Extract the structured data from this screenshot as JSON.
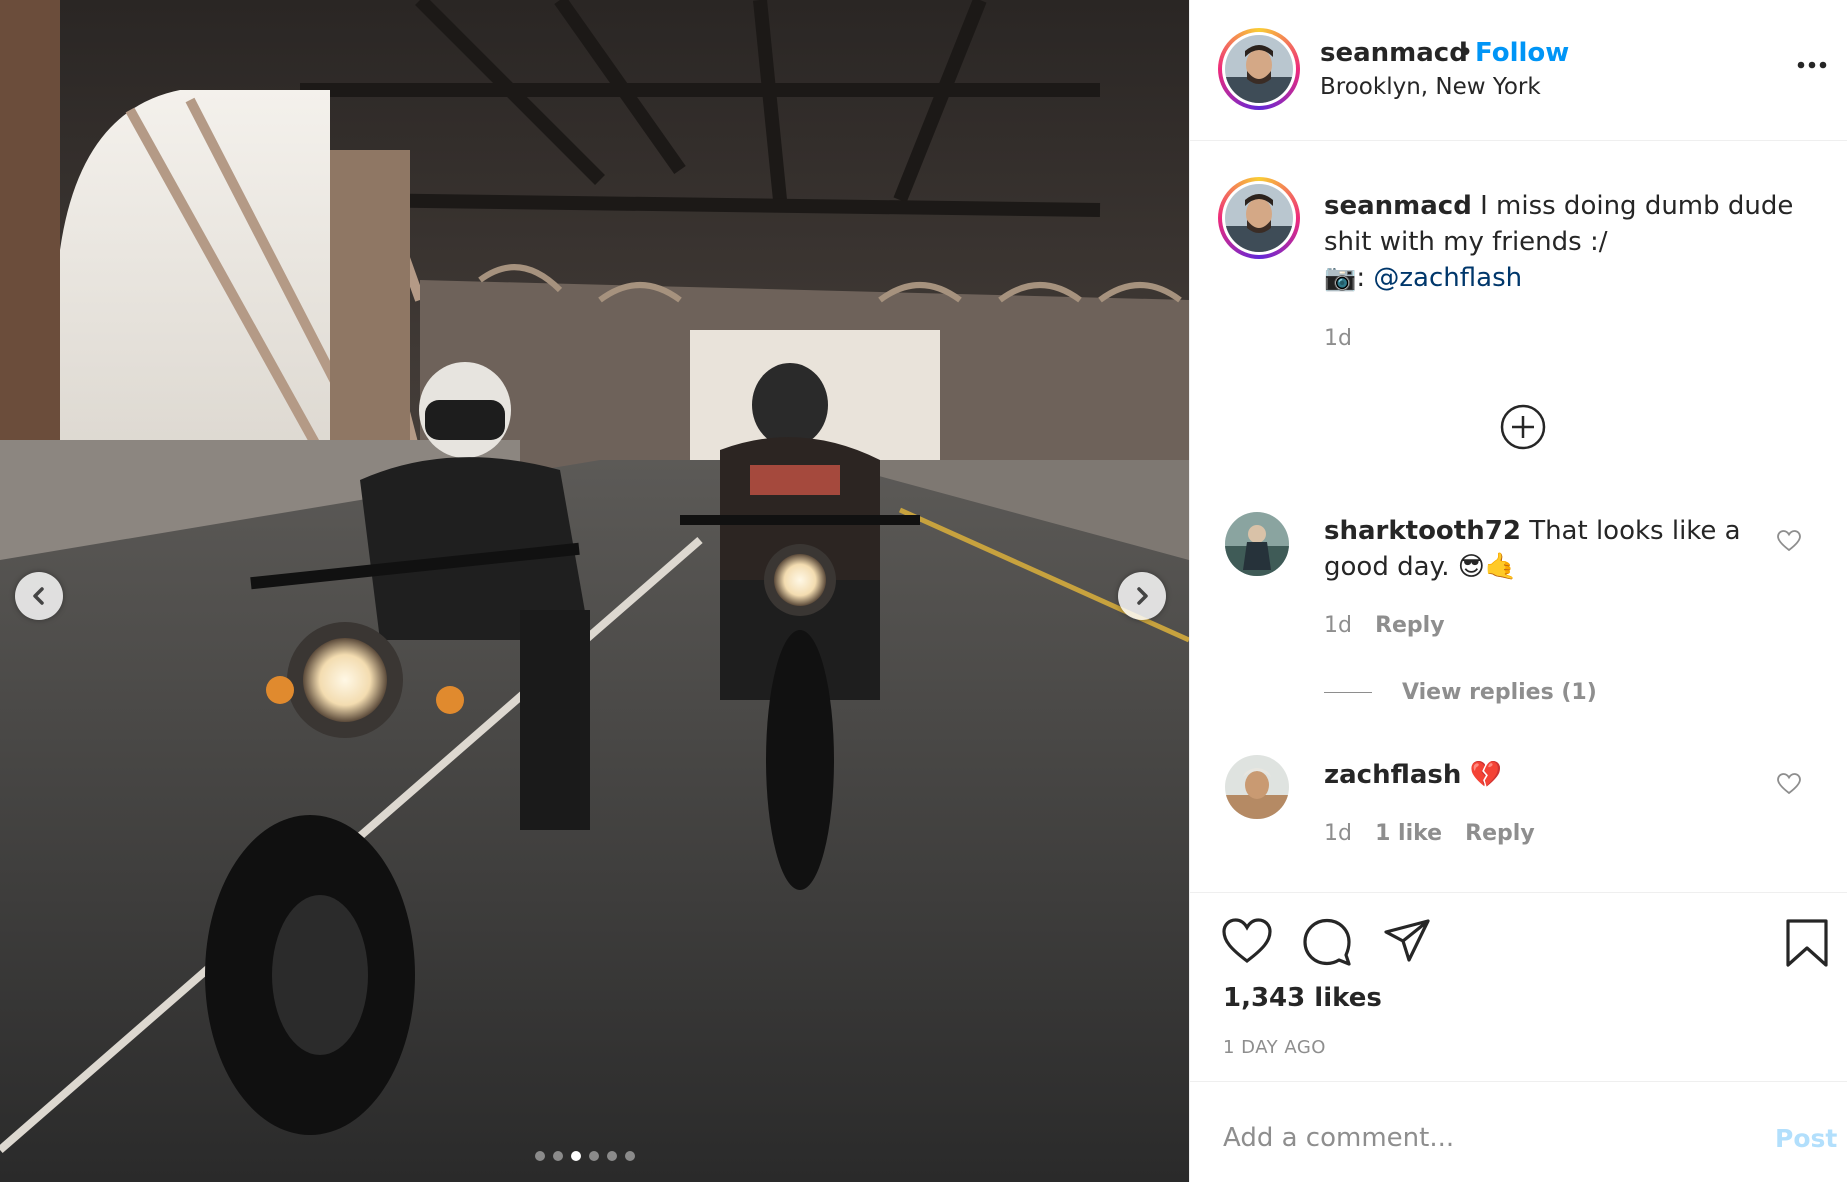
{
  "post": {
    "username": "seanmacd",
    "separator": "•",
    "follow_label": "Follow",
    "location": "Brooklyn, New York",
    "more_icon": "more-horizontal-icon"
  },
  "media": {
    "slide_count": 6,
    "active_slide": 3,
    "prev_icon": "chevron-left-icon",
    "next_icon": "chevron-right-icon"
  },
  "caption": {
    "username": "seanmacd",
    "text": "I miss doing dumb dude shit with my friends :/",
    "camera_emoji": "📷",
    "colon": ":",
    "mention": "@zachflash",
    "time": "1d"
  },
  "load_more_icon": "plus-circle-icon",
  "comments": [
    {
      "username": "sharktooth72",
      "text": "That looks like a good day.",
      "emojis": "😎🤙",
      "time": "1d",
      "reply_label": "Reply",
      "view_replies": "View replies (1)"
    },
    {
      "username": "zachflash",
      "text": "",
      "emojis": "💔",
      "time": "1d",
      "likes": "1 like",
      "reply_label": "Reply"
    }
  ],
  "actions": {
    "like_icon": "heart-icon",
    "comment_icon": "comment-icon",
    "share_icon": "paper-plane-icon",
    "save_icon": "bookmark-icon"
  },
  "likes_count": "1,343 likes",
  "post_date": "1 DAY AGO",
  "comment_box": {
    "placeholder": "Add a comment...",
    "post_label": "Post"
  },
  "colors": {
    "follow": "#0095f6",
    "post_disabled": "#b2dffc",
    "mention": "#00376b",
    "meta": "#8e8e8e"
  }
}
